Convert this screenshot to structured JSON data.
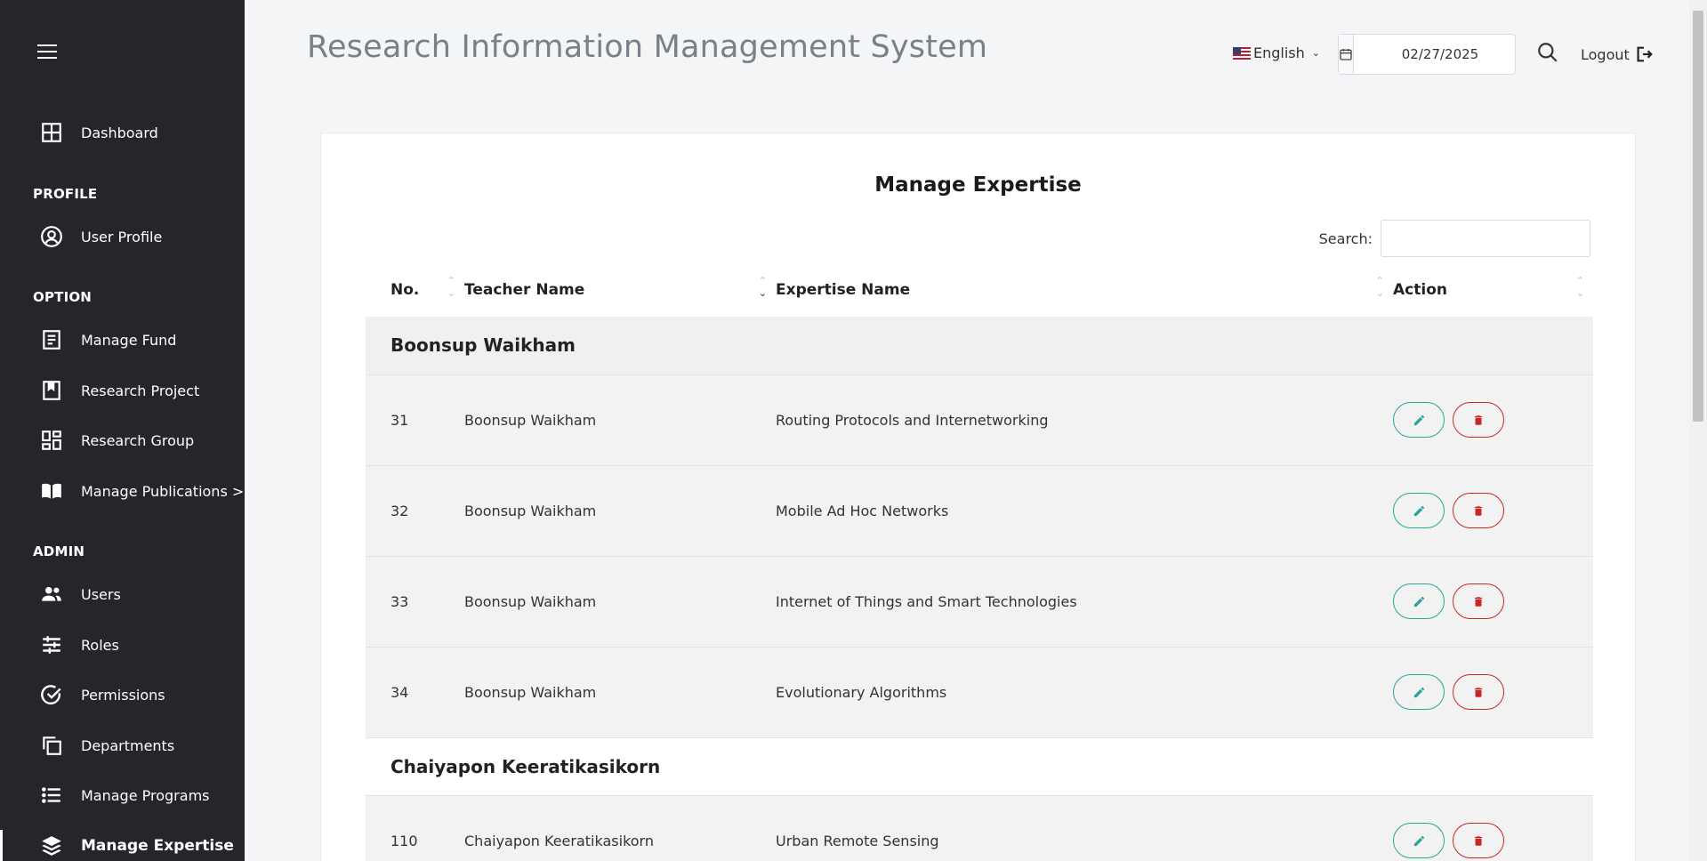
{
  "sidebar": {
    "sections": {
      "profile": "PROFILE",
      "option": "OPTION",
      "admin": "ADMIN"
    },
    "items": {
      "dashboard": "Dashboard",
      "user_profile": "User Profile",
      "manage_fund": "Manage Fund",
      "research_project": "Research Project",
      "research_group": "Research Group",
      "manage_publications": "Manage Publications >",
      "users": "Users",
      "roles": "Roles",
      "permissions": "Permissions",
      "departments": "Departments",
      "manage_programs": "Manage Programs",
      "manage_expertise": "Manage Expertise"
    }
  },
  "header": {
    "title": "Research Information Management System",
    "language": "English",
    "date": "02/27/2025",
    "logout": "Logout"
  },
  "main": {
    "title": "Manage Expertise",
    "search_label": "Search:",
    "search_value": "",
    "columns": {
      "no": "No.",
      "teacher": "Teacher Name",
      "expertise": "Expertise Name",
      "action": "Action"
    },
    "groups": [
      {
        "name": "Boonsup Waikham",
        "rows": [
          {
            "no": "31",
            "teacher": "Boonsup Waikham",
            "expertise": "Routing Protocols and Internetworking"
          },
          {
            "no": "32",
            "teacher": "Boonsup Waikham",
            "expertise": "Mobile Ad Hoc Networks"
          },
          {
            "no": "33",
            "teacher": "Boonsup Waikham",
            "expertise": "Internet of Things and Smart Technologies"
          },
          {
            "no": "34",
            "teacher": "Boonsup Waikham",
            "expertise": "Evolutionary Algorithms"
          }
        ]
      },
      {
        "name": "Chaiyapon Keeratikasikorn",
        "rows": [
          {
            "no": "110",
            "teacher": "Chaiyapon Keeratikasikorn",
            "expertise": "Urban Remote Sensing"
          }
        ]
      }
    ]
  },
  "colors": {
    "sidebar_bg": "#25262b",
    "edit_accent": "#26a69a",
    "delete_accent": "#c62828"
  }
}
